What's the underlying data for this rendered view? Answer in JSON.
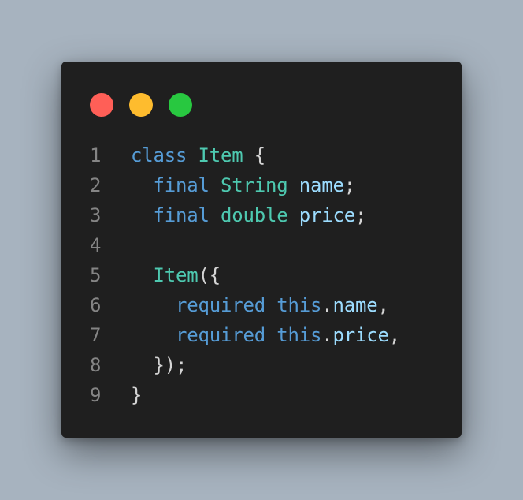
{
  "window": {
    "controls": [
      {
        "name": "close",
        "color": "#ff5f57"
      },
      {
        "name": "minimize",
        "color": "#febc2e"
      },
      {
        "name": "maximize",
        "color": "#28c840"
      }
    ]
  },
  "colors": {
    "background": "#a7b3bf",
    "editor": "#1f1f1f",
    "keyword": "#569cd6",
    "type": "#4ec9b0",
    "variable": "#9cdcfe",
    "punctuation": "#d4d4d4",
    "line_number": "#858585"
  },
  "code": {
    "lines": [
      {
        "num": "1",
        "tokens": [
          {
            "t": "class",
            "k": "kw"
          },
          {
            "t": " ",
            "k": "punc"
          },
          {
            "t": "Item",
            "k": "type"
          },
          {
            "t": " {",
            "k": "punc"
          }
        ]
      },
      {
        "num": "2",
        "tokens": [
          {
            "t": "  ",
            "k": "punc"
          },
          {
            "t": "final",
            "k": "kw"
          },
          {
            "t": " ",
            "k": "punc"
          },
          {
            "t": "String",
            "k": "type"
          },
          {
            "t": " ",
            "k": "punc"
          },
          {
            "t": "name",
            "k": "var"
          },
          {
            "t": ";",
            "k": "punc"
          }
        ]
      },
      {
        "num": "3",
        "tokens": [
          {
            "t": "  ",
            "k": "punc"
          },
          {
            "t": "final",
            "k": "kw"
          },
          {
            "t": " ",
            "k": "punc"
          },
          {
            "t": "double",
            "k": "type"
          },
          {
            "t": " ",
            "k": "punc"
          },
          {
            "t": "price",
            "k": "var"
          },
          {
            "t": ";",
            "k": "punc"
          }
        ]
      },
      {
        "num": "4",
        "tokens": []
      },
      {
        "num": "5",
        "tokens": [
          {
            "t": "  ",
            "k": "punc"
          },
          {
            "t": "Item",
            "k": "type"
          },
          {
            "t": "({",
            "k": "punc"
          }
        ]
      },
      {
        "num": "6",
        "tokens": [
          {
            "t": "    ",
            "k": "punc"
          },
          {
            "t": "required",
            "k": "kw"
          },
          {
            "t": " ",
            "k": "punc"
          },
          {
            "t": "this",
            "k": "kw"
          },
          {
            "t": ".",
            "k": "punc"
          },
          {
            "t": "name",
            "k": "var"
          },
          {
            "t": ",",
            "k": "punc"
          }
        ]
      },
      {
        "num": "7",
        "tokens": [
          {
            "t": "    ",
            "k": "punc"
          },
          {
            "t": "required",
            "k": "kw"
          },
          {
            "t": " ",
            "k": "punc"
          },
          {
            "t": "this",
            "k": "kw"
          },
          {
            "t": ".",
            "k": "punc"
          },
          {
            "t": "price",
            "k": "var"
          },
          {
            "t": ",",
            "k": "punc"
          }
        ]
      },
      {
        "num": "8",
        "tokens": [
          {
            "t": "  ",
            "k": "punc"
          },
          {
            "t": "});",
            "k": "punc"
          }
        ]
      },
      {
        "num": "9",
        "tokens": [
          {
            "t": "}",
            "k": "punc"
          }
        ]
      }
    ]
  }
}
